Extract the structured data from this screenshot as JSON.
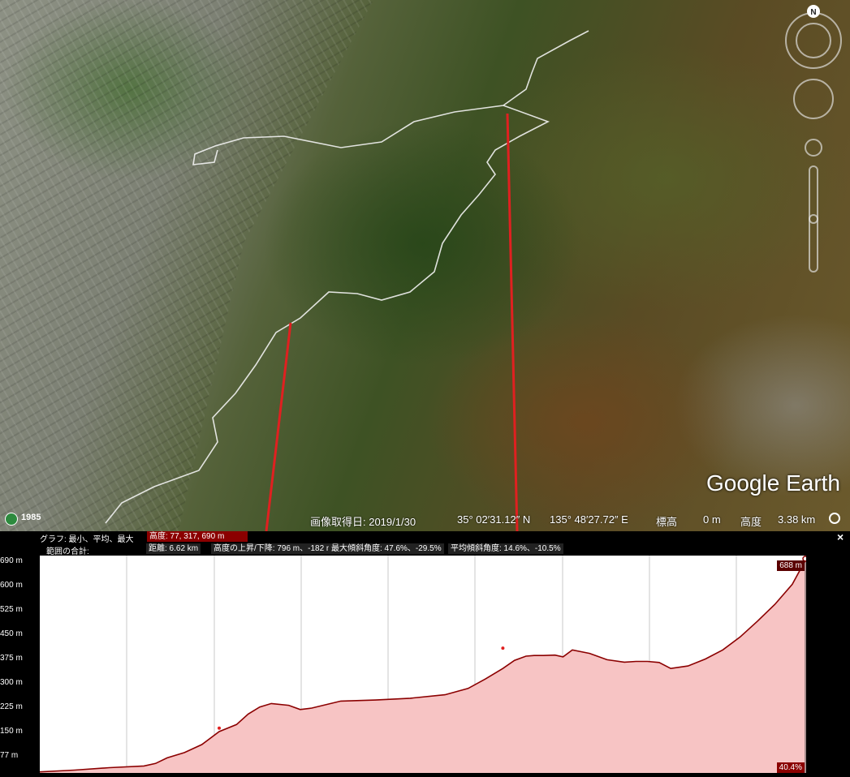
{
  "map": {
    "logo": "Google Earth",
    "compass_label": "N",
    "year_badge": "1985",
    "status": {
      "image_date": "画像取得日: 2019/1/30",
      "lat": "35° 02′31.12″ N",
      "lon": "135° 48′27.72″ E",
      "elev_label": "標高",
      "elev_value": "0 m",
      "alt_label": "高度",
      "alt_value": "3.38 km"
    }
  },
  "profile": {
    "graph_label": "グラフ: 最小、平均、最大",
    "elevation_stats": "高度: 77, 317, 690 m",
    "range_label": "範囲の合計:",
    "distance": "距離: 6.62 km",
    "gain_loss": "高度の上昇/下降: 796 m、-182 m",
    "max_slope": "最大傾斜角度: 47.6%、-29.5%",
    "avg_slope": "平均傾斜角度: 14.6%、-10.5%",
    "close_symbol": "×",
    "current_elev": "688 m",
    "current_slope": "40.4%",
    "colors": {
      "line": "#8b0000",
      "fill": "#f7c4c4",
      "annotation": "#e02020"
    }
  },
  "chart_data": {
    "type": "area",
    "xlabel": "",
    "ylabel": "",
    "y_ticks": [
      "690 m",
      "600 m",
      "525 m",
      "450 m",
      "375 m",
      "300 m",
      "225 m",
      "150 m",
      "77 m"
    ],
    "y_tick_values": [
      690,
      600,
      525,
      450,
      375,
      300,
      225,
      150,
      77
    ],
    "ylim": [
      77,
      690
    ],
    "xlim": [
      0,
      6.62
    ],
    "grid": true,
    "series": [
      {
        "x": [
          0,
          0.3,
          0.6,
          0.9,
          1.0,
          1.1,
          1.25,
          1.4,
          1.55,
          1.7,
          1.8,
          1.9,
          2.0,
          2.15,
          2.25,
          2.35,
          2.6,
          2.9,
          3.2,
          3.5,
          3.7,
          3.85,
          4.0,
          4.1,
          4.2,
          4.27,
          4.35,
          4.45,
          4.52,
          4.6,
          4.75,
          4.9,
          5.05,
          5.15,
          5.25,
          5.35,
          5.45,
          5.6,
          5.75,
          5.9,
          6.05,
          6.2,
          6.35,
          6.5,
          6.62
        ],
        "values": [
          80,
          85,
          92,
          97,
          104,
          120,
          135,
          158,
          195,
          215,
          245,
          265,
          275,
          270,
          258,
          262,
          282,
          285,
          290,
          300,
          318,
          345,
          375,
          398,
          410,
          412,
          412,
          413,
          408,
          428,
          418,
          400,
          393,
          395,
          395,
          392,
          375,
          382,
          402,
          428,
          465,
          510,
          558,
          615,
          688
        ]
      }
    ],
    "markers": [
      {
        "x": 1.55,
        "y": 205
      },
      {
        "x": 4.0,
        "y": 433
      }
    ]
  }
}
